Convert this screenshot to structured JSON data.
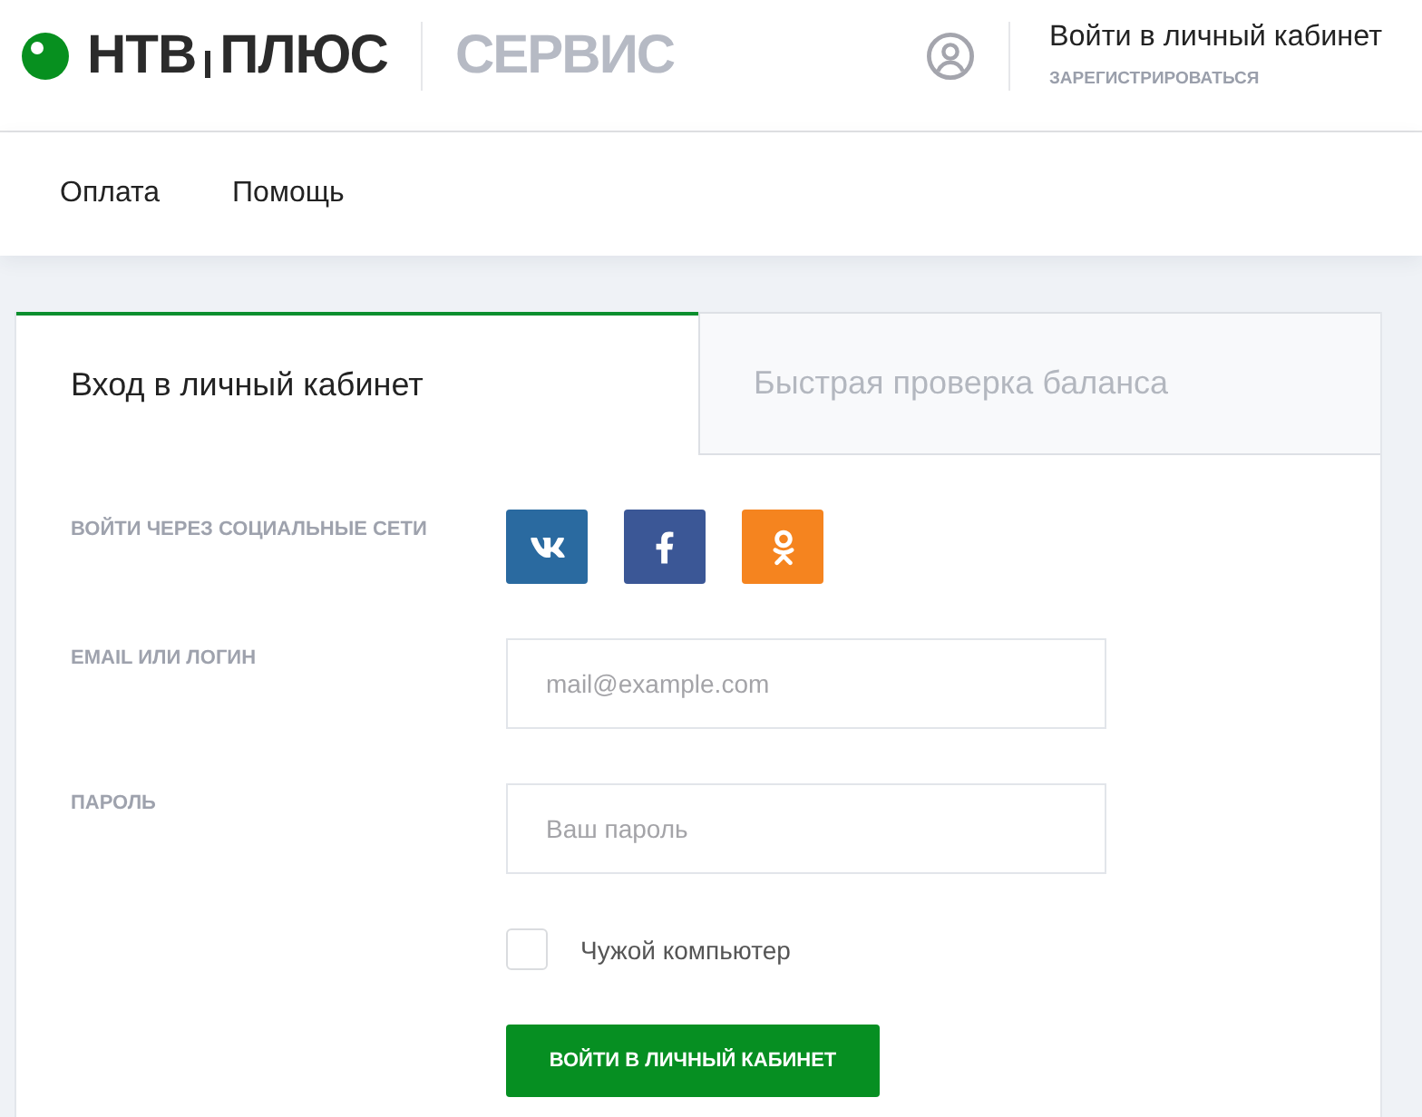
{
  "header": {
    "logo": {
      "words": [
        "НТВ",
        "ПЛЮС"
      ],
      "service": "СЕРВИС"
    },
    "account": {
      "title": "Войти в личный кабинет",
      "register": "ЗАРЕГИСТРИРОВАТЬСЯ"
    }
  },
  "nav": {
    "items": [
      {
        "label": "Оплата"
      },
      {
        "label": "Помощь"
      }
    ]
  },
  "tabs": [
    {
      "label": "Вход в личный кабинет",
      "selected": true
    },
    {
      "label": "Быстрая проверка баланса",
      "selected": false
    }
  ],
  "form": {
    "social": {
      "label": "ВОЙТИ ЧЕРЕЗ СОЦИАЛЬНЫЕ СЕТИ",
      "networks": [
        {
          "kind": "vk",
          "color": "#2a6aa0"
        },
        {
          "kind": "facebook",
          "color": "#3b5796"
        },
        {
          "kind": "odnoklassniki",
          "color": "#f5841f"
        }
      ]
    },
    "fields": [
      {
        "label": "EMAIL ИЛИ ЛОГИН",
        "placeholder": "mail@example.com"
      },
      {
        "label": "ПАРОЛЬ",
        "placeholder": "Ваш пароль"
      }
    ],
    "remember": {
      "label": "Чужой компьютер",
      "checked": false
    },
    "submit": "ВОЙТИ В ЛИЧНЫЙ КАБИНЕТ"
  }
}
